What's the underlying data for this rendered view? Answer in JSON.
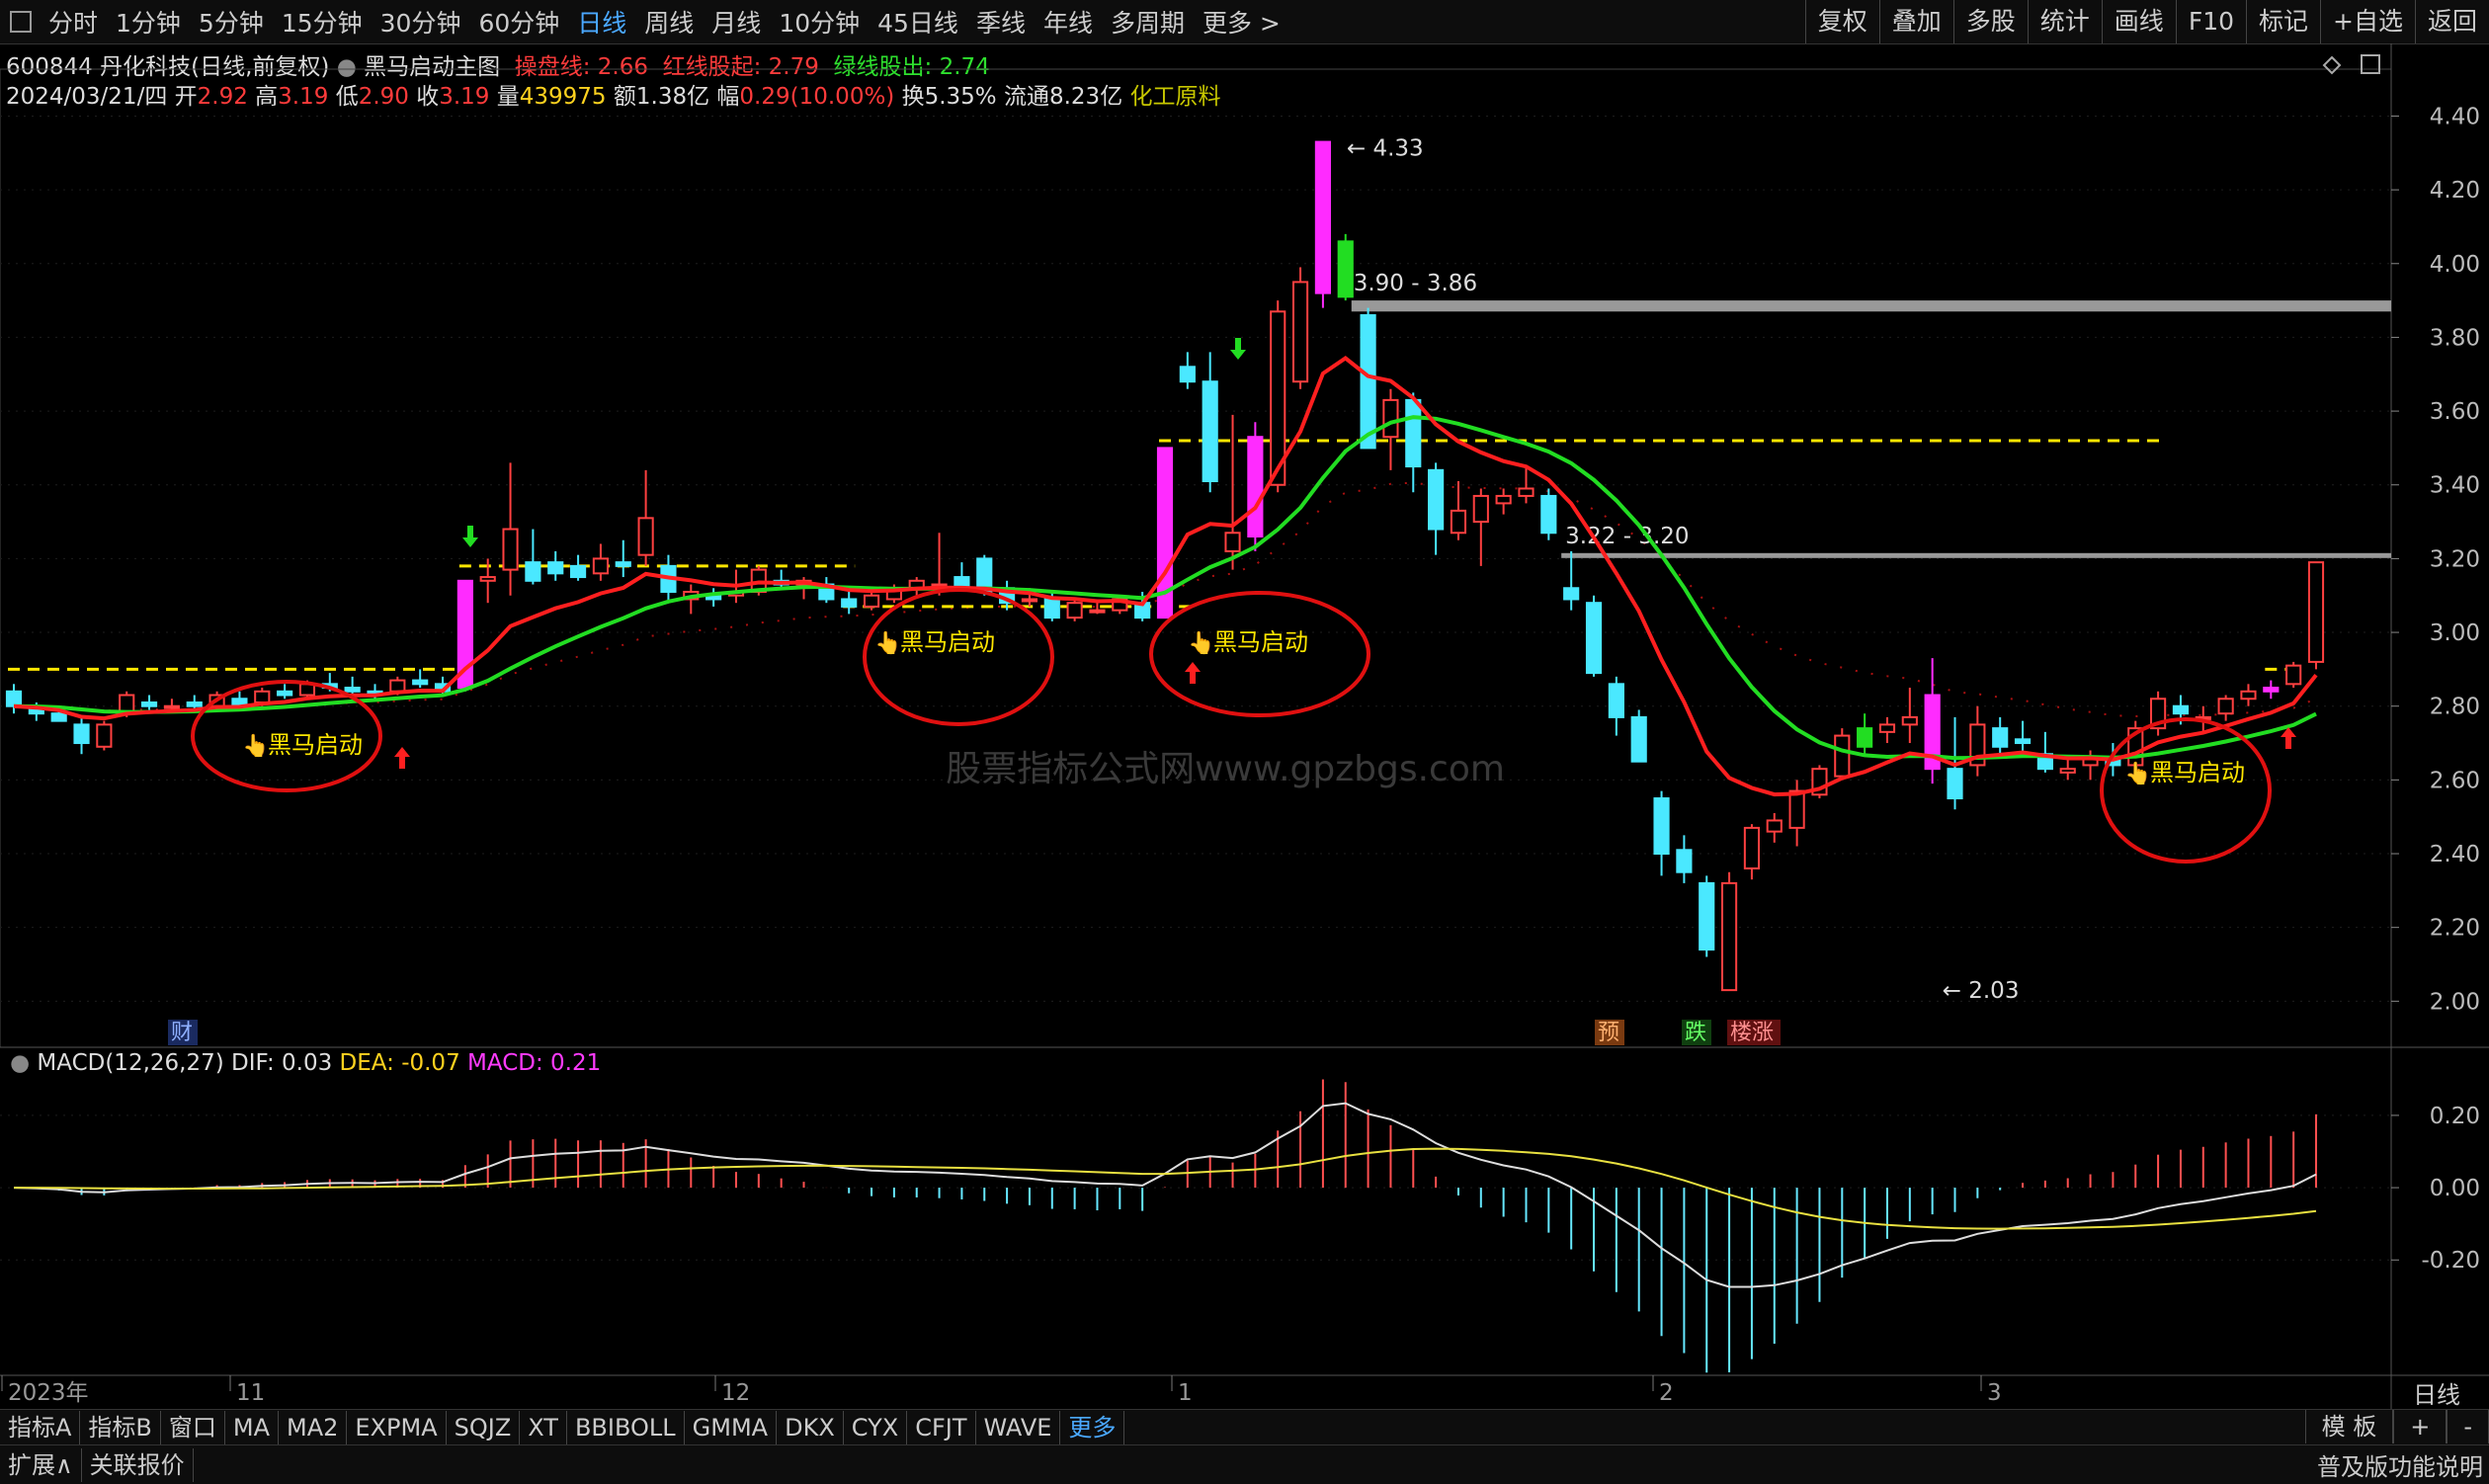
{
  "toolbar": {
    "periods": [
      "分时",
      "1分钟",
      "5分钟",
      "15分钟",
      "30分钟",
      "60分钟",
      "日线",
      "周线",
      "月线",
      "10分钟",
      "45日线",
      "季线",
      "年线",
      "多周期",
      "更多 >"
    ],
    "active_period": "日线",
    "tools": [
      "复权",
      "叠加",
      "多股",
      "统计",
      "画线",
      "F10",
      "标记",
      "+自选",
      "返回"
    ]
  },
  "stock": {
    "code_name": "600844 丹化科技(日线,前复权)",
    "indicator": "黑马启动主图",
    "caopan_label": "操盘线:",
    "caopan_value": "2.66",
    "hongxian_label": "红线股起:",
    "hongxian_value": "2.79",
    "lvxian_label": "绿线股出:",
    "lvxian_value": "2.74",
    "date": "2024/03/21/四",
    "open_label": "开",
    "open": "2.92",
    "high_label": "高",
    "high": "3.19",
    "low_label": "低",
    "low": "2.90",
    "close_label": "收",
    "close": "3.19",
    "vol_label": "量",
    "vol": "439975",
    "amount_label": "额",
    "amount": "1.38亿",
    "change_label": "幅",
    "change": "0.29(10.00%)",
    "turnover_label": "换",
    "turnover": "5.35%",
    "float_label": "流通",
    "float_cap": "8.23亿",
    "sector": "化工原料"
  },
  "macd": {
    "label": "MACD(12,26,27)",
    "dif_label": "DIF:",
    "dif": "0.03",
    "dea_label": "DEA:",
    "dea": "-0.07",
    "macd_label": "MACD:",
    "macd": "0.21"
  },
  "bottom_tabs": [
    "指标A",
    "指标B",
    "窗口",
    "MA",
    "MA2",
    "EXPMA",
    "SQJZ",
    "XT",
    "BBIBOLL",
    "GMMA",
    "DKX",
    "CYX",
    "CFJT",
    "WAVE",
    "更多"
  ],
  "bottom_active": "更多",
  "bottom_right": [
    "模 板",
    "+",
    "-"
  ],
  "bottom2_left": [
    "扩展∧",
    "关联报价"
  ],
  "bottom2_right": "普及版功能说明",
  "colors": {
    "up": "#ff4040",
    "down": "#4ae8ff",
    "magenta": "#ff2bff",
    "green_bar": "#22dd22",
    "red_line": "#ff1f1f",
    "green_line": "#22dd22",
    "yellow_dash": "#ffe600"
  },
  "chart_data": {
    "type": "candlestick",
    "title": "",
    "x_ticks": [
      "2023年",
      "11",
      "12",
      "1",
      "2",
      "3"
    ],
    "y_ticks": [
      "4.40",
      "4.20",
      "4.00",
      "3.80",
      "3.60",
      "3.40",
      "3.20",
      "3.00",
      "2.80",
      "2.60",
      "2.40",
      "2.20",
      "2.00"
    ],
    "ylim": [
      1.95,
      4.42
    ],
    "macd_ticks": [
      "0.20",
      "0.00",
      "-0.20"
    ],
    "macd_ylim": [
      -0.5,
      0.32
    ],
    "candles": [
      {
        "o": 2.84,
        "h": 2.86,
        "l": 2.78,
        "c": 2.8
      },
      {
        "o": 2.79,
        "h": 2.81,
        "l": 2.76,
        "c": 2.78
      },
      {
        "o": 2.78,
        "h": 2.8,
        "l": 2.76,
        "c": 2.76
      },
      {
        "o": 2.75,
        "h": 2.77,
        "l": 2.67,
        "c": 2.7
      },
      {
        "o": 2.69,
        "h": 2.76,
        "l": 2.68,
        "c": 2.75
      },
      {
        "o": 2.78,
        "h": 2.84,
        "l": 2.77,
        "c": 2.83
      },
      {
        "o": 2.81,
        "h": 2.83,
        "l": 2.79,
        "c": 2.8
      },
      {
        "o": 2.8,
        "h": 2.82,
        "l": 2.79,
        "c": 2.8
      },
      {
        "o": 2.81,
        "h": 2.83,
        "l": 2.79,
        "c": 2.8
      },
      {
        "o": 2.8,
        "h": 2.84,
        "l": 2.79,
        "c": 2.83
      },
      {
        "o": 2.82,
        "h": 2.84,
        "l": 2.79,
        "c": 2.8
      },
      {
        "o": 2.81,
        "h": 2.85,
        "l": 2.8,
        "c": 2.84
      },
      {
        "o": 2.84,
        "h": 2.86,
        "l": 2.82,
        "c": 2.83
      },
      {
        "o": 2.83,
        "h": 2.87,
        "l": 2.82,
        "c": 2.86
      },
      {
        "o": 2.86,
        "h": 2.89,
        "l": 2.84,
        "c": 2.85
      },
      {
        "o": 2.85,
        "h": 2.88,
        "l": 2.83,
        "c": 2.84
      },
      {
        "o": 2.84,
        "h": 2.86,
        "l": 2.82,
        "c": 2.83
      },
      {
        "o": 2.84,
        "h": 2.88,
        "l": 2.83,
        "c": 2.87
      },
      {
        "o": 2.87,
        "h": 2.9,
        "l": 2.85,
        "c": 2.86
      },
      {
        "o": 2.86,
        "h": 2.88,
        "l": 2.83,
        "c": 2.84
      },
      {
        "o": 2.85,
        "h": 3.14,
        "l": 2.84,
        "c": 3.14
      },
      {
        "o": 3.14,
        "h": 3.2,
        "l": 3.08,
        "c": 3.15
      },
      {
        "o": 3.17,
        "h": 3.46,
        "l": 3.1,
        "c": 3.28
      },
      {
        "o": 3.19,
        "h": 3.28,
        "l": 3.13,
        "c": 3.14
      },
      {
        "o": 3.19,
        "h": 3.22,
        "l": 3.14,
        "c": 3.16
      },
      {
        "o": 3.18,
        "h": 3.21,
        "l": 3.14,
        "c": 3.15
      },
      {
        "o": 3.16,
        "h": 3.24,
        "l": 3.14,
        "c": 3.2
      },
      {
        "o": 3.19,
        "h": 3.25,
        "l": 3.15,
        "c": 3.18
      },
      {
        "o": 3.21,
        "h": 3.44,
        "l": 3.18,
        "c": 3.31
      },
      {
        "o": 3.18,
        "h": 3.21,
        "l": 3.08,
        "c": 3.11
      },
      {
        "o": 3.09,
        "h": 3.13,
        "l": 3.05,
        "c": 3.11
      },
      {
        "o": 3.1,
        "h": 3.12,
        "l": 3.07,
        "c": 3.09
      },
      {
        "o": 3.1,
        "h": 3.17,
        "l": 3.08,
        "c": 3.11
      },
      {
        "o": 3.11,
        "h": 3.18,
        "l": 3.1,
        "c": 3.17
      },
      {
        "o": 3.14,
        "h": 3.17,
        "l": 3.12,
        "c": 3.13
      },
      {
        "o": 3.13,
        "h": 3.15,
        "l": 3.09,
        "c": 3.14
      },
      {
        "o": 3.13,
        "h": 3.15,
        "l": 3.08,
        "c": 3.09
      },
      {
        "o": 3.09,
        "h": 3.11,
        "l": 3.05,
        "c": 3.07
      },
      {
        "o": 3.07,
        "h": 3.11,
        "l": 3.06,
        "c": 3.1
      },
      {
        "o": 3.09,
        "h": 3.13,
        "l": 3.08,
        "c": 3.12
      },
      {
        "o": 3.12,
        "h": 3.15,
        "l": 3.1,
        "c": 3.14
      },
      {
        "o": 3.13,
        "h": 3.27,
        "l": 3.1,
        "c": 3.13
      },
      {
        "o": 3.15,
        "h": 3.19,
        "l": 3.11,
        "c": 3.12
      },
      {
        "o": 3.2,
        "h": 3.21,
        "l": 3.1,
        "c": 3.11
      },
      {
        "o": 3.12,
        "h": 3.14,
        "l": 3.06,
        "c": 3.08
      },
      {
        "o": 3.09,
        "h": 3.12,
        "l": 3.07,
        "c": 3.09
      },
      {
        "o": 3.09,
        "h": 3.11,
        "l": 3.03,
        "c": 3.04
      },
      {
        "o": 3.04,
        "h": 3.09,
        "l": 3.03,
        "c": 3.08
      },
      {
        "o": 3.06,
        "h": 3.09,
        "l": 3.05,
        "c": 3.06
      },
      {
        "o": 3.06,
        "h": 3.1,
        "l": 3.05,
        "c": 3.09
      },
      {
        "o": 3.08,
        "h": 3.11,
        "l": 3.03,
        "c": 3.04
      },
      {
        "o": 3.04,
        "h": 3.5,
        "l": 3.04,
        "c": 3.5
      },
      {
        "o": 3.72,
        "h": 3.76,
        "l": 3.66,
        "c": 3.68
      },
      {
        "o": 3.68,
        "h": 3.76,
        "l": 3.38,
        "c": 3.41
      },
      {
        "o": 3.22,
        "h": 3.59,
        "l": 3.17,
        "c": 3.27
      },
      {
        "o": 3.26,
        "h": 3.57,
        "l": 3.22,
        "c": 3.53
      },
      {
        "o": 3.4,
        "h": 3.9,
        "l": 3.38,
        "c": 3.87
      },
      {
        "o": 3.68,
        "h": 3.99,
        "l": 3.66,
        "c": 3.95
      },
      {
        "o": 3.92,
        "h": 4.33,
        "l": 3.88,
        "c": 4.33
      },
      {
        "o": 4.06,
        "h": 4.08,
        "l": 3.9,
        "c": 3.91
      },
      {
        "o": 3.86,
        "h": 3.88,
        "l": 3.5,
        "c": 3.5
      },
      {
        "o": 3.53,
        "h": 3.66,
        "l": 3.44,
        "c": 3.63
      },
      {
        "o": 3.63,
        "h": 3.65,
        "l": 3.38,
        "c": 3.45
      },
      {
        "o": 3.44,
        "h": 3.46,
        "l": 3.21,
        "c": 3.28
      },
      {
        "o": 3.27,
        "h": 3.41,
        "l": 3.25,
        "c": 3.33
      },
      {
        "o": 3.3,
        "h": 3.39,
        "l": 3.18,
        "c": 3.37
      },
      {
        "o": 3.35,
        "h": 3.39,
        "l": 3.32,
        "c": 3.37
      },
      {
        "o": 3.37,
        "h": 3.45,
        "l": 3.35,
        "c": 3.39
      },
      {
        "o": 3.37,
        "h": 3.39,
        "l": 3.25,
        "c": 3.27
      },
      {
        "o": 3.12,
        "h": 3.22,
        "l": 3.06,
        "c": 3.09
      },
      {
        "o": 3.08,
        "h": 3.1,
        "l": 2.88,
        "c": 2.89
      },
      {
        "o": 2.86,
        "h": 2.88,
        "l": 2.72,
        "c": 2.77
      },
      {
        "o": 2.77,
        "h": 2.79,
        "l": 2.65,
        "c": 2.65
      },
      {
        "o": 2.55,
        "h": 2.57,
        "l": 2.34,
        "c": 2.4
      },
      {
        "o": 2.41,
        "h": 2.45,
        "l": 2.32,
        "c": 2.35
      },
      {
        "o": 2.32,
        "h": 2.34,
        "l": 2.12,
        "c": 2.14
      },
      {
        "o": 2.03,
        "h": 2.35,
        "l": 2.03,
        "c": 2.32
      },
      {
        "o": 2.36,
        "h": 2.48,
        "l": 2.33,
        "c": 2.47
      },
      {
        "o": 2.46,
        "h": 2.51,
        "l": 2.43,
        "c": 2.49
      },
      {
        "o": 2.47,
        "h": 2.6,
        "l": 2.42,
        "c": 2.57
      },
      {
        "o": 2.56,
        "h": 2.64,
        "l": 2.55,
        "c": 2.63
      },
      {
        "o": 2.61,
        "h": 2.74,
        "l": 2.6,
        "c": 2.72
      },
      {
        "o": 2.74,
        "h": 2.78,
        "l": 2.67,
        "c": 2.69
      },
      {
        "o": 2.73,
        "h": 2.77,
        "l": 2.7,
        "c": 2.75
      },
      {
        "o": 2.75,
        "h": 2.85,
        "l": 2.7,
        "c": 2.77
      },
      {
        "o": 2.83,
        "h": 2.93,
        "l": 2.59,
        "c": 2.63
      },
      {
        "o": 2.63,
        "h": 2.77,
        "l": 2.52,
        "c": 2.55
      },
      {
        "o": 2.64,
        "h": 2.8,
        "l": 2.61,
        "c": 2.75
      },
      {
        "o": 2.74,
        "h": 2.77,
        "l": 2.67,
        "c": 2.69
      },
      {
        "o": 2.71,
        "h": 2.76,
        "l": 2.68,
        "c": 2.7
      },
      {
        "o": 2.67,
        "h": 2.73,
        "l": 2.62,
        "c": 2.63
      },
      {
        "o": 2.62,
        "h": 2.66,
        "l": 2.6,
        "c": 2.63
      },
      {
        "o": 2.64,
        "h": 2.68,
        "l": 2.6,
        "c": 2.66
      },
      {
        "o": 2.66,
        "h": 2.7,
        "l": 2.61,
        "c": 2.64
      },
      {
        "o": 2.64,
        "h": 2.76,
        "l": 2.63,
        "c": 2.74
      },
      {
        "o": 2.74,
        "h": 2.84,
        "l": 2.72,
        "c": 2.82
      },
      {
        "o": 2.8,
        "h": 2.83,
        "l": 2.75,
        "c": 2.78
      },
      {
        "o": 2.77,
        "h": 2.8,
        "l": 2.73,
        "c": 2.77
      },
      {
        "o": 2.78,
        "h": 2.83,
        "l": 2.76,
        "c": 2.82
      },
      {
        "o": 2.82,
        "h": 2.86,
        "l": 2.8,
        "c": 2.84
      },
      {
        "o": 2.84,
        "h": 2.87,
        "l": 2.82,
        "c": 2.85
      },
      {
        "o": 2.86,
        "h": 2.92,
        "l": 2.85,
        "c": 2.91
      },
      {
        "o": 2.92,
        "h": 3.19,
        "l": 2.9,
        "c": 3.19
      }
    ],
    "special_bars": {
      "magenta": [
        20,
        51,
        55,
        58,
        85,
        100
      ],
      "green": [
        59,
        82
      ]
    },
    "annotations": {
      "high_label": "4.33",
      "low_label": "2.03",
      "resist1_label": "3.90 - 3.86",
      "resist2_label": "3.22 - 3.20",
      "signal_label": "黑马启动",
      "marker_cai": "财",
      "marker_yu": "预",
      "marker_die": "跌",
      "marker_louzhang": "楼涨",
      "watermark": "股票指标公式网www.gpzbgs.com"
    }
  }
}
